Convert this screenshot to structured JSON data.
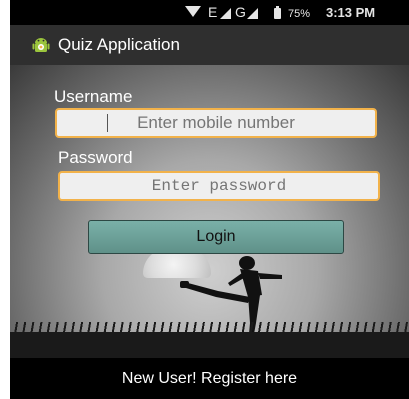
{
  "status_bar": {
    "network_e": "E",
    "network_g": "G",
    "battery": "75%",
    "time": "3:13 PM"
  },
  "action_bar": {
    "title": "Quiz Application",
    "icon": "android-icon"
  },
  "form": {
    "username_label": "Username",
    "username_placeholder": "Enter mobile number",
    "password_label": "Password",
    "password_placeholder": "Enter password",
    "login_label": "Login"
  },
  "footer": {
    "register_label": "New User! Register here"
  },
  "colors": {
    "field_border": "#f2b24a",
    "button": "#6fa39b",
    "action_bar": "#2f2f2f"
  }
}
